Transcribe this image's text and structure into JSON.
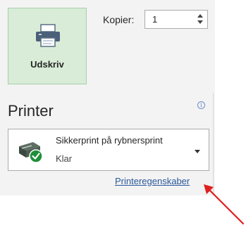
{
  "print": {
    "button_label": "Udskriv",
    "icon": "printer-icon"
  },
  "copies": {
    "label": "Kopier:",
    "value": "1"
  },
  "printer": {
    "section_title": "Printer",
    "info_icon": "info-icon",
    "selected_name": "Sikkerprint på rybnersprint",
    "status": "Klar",
    "status_icon": "printer-ready-icon",
    "properties_link": "Printeregenskaber"
  },
  "colors": {
    "print_button_bg": "#d8ecd8",
    "link": "#2a579a",
    "annotation_arrow": "#e02020",
    "ready_check": "#1f8f3a"
  }
}
